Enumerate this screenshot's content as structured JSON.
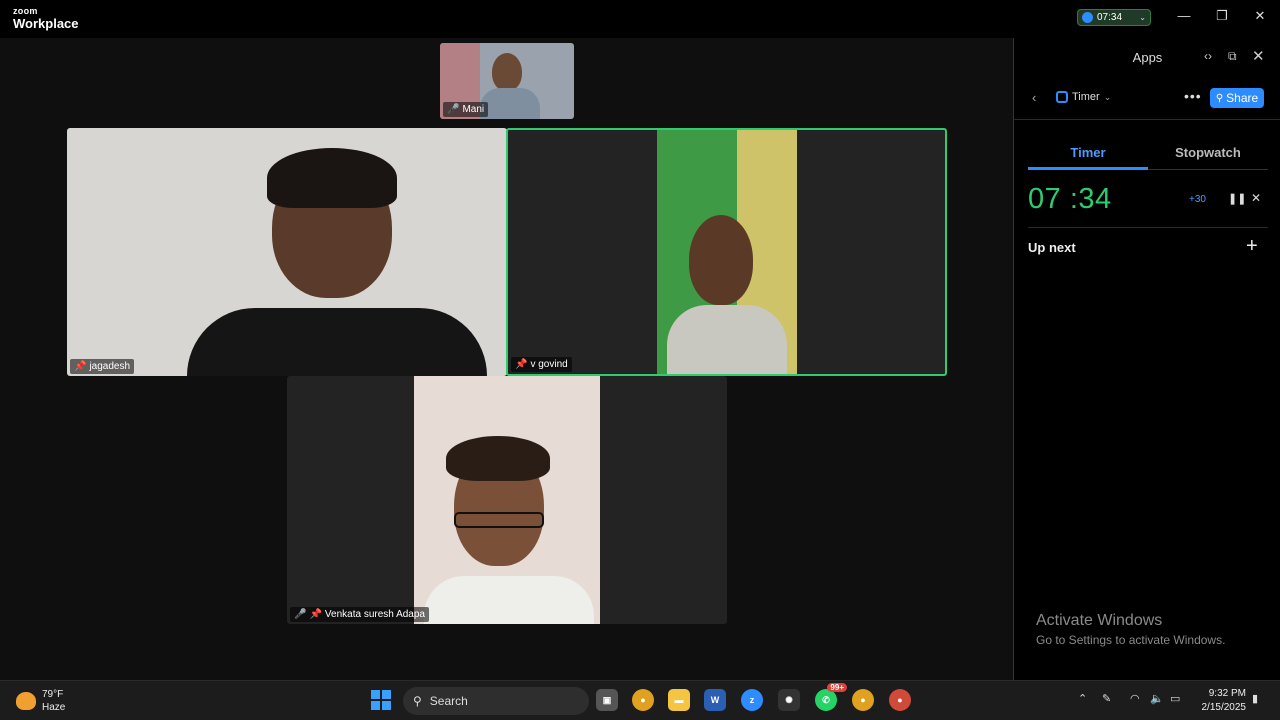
{
  "app": {
    "brand_small": "zoom",
    "brand_name": "Workplace",
    "timer_pill": "07:34"
  },
  "window_controls": {
    "minimize": "—",
    "maximize": "❐",
    "close": "✕"
  },
  "participants": {
    "top": {
      "name": "Mani"
    },
    "left": {
      "name": "jagadesh"
    },
    "right": {
      "name": "v govind"
    },
    "bottom": {
      "name": "Venkata suresh Adapa"
    }
  },
  "panel": {
    "title": "Apps",
    "app_name": "Timer",
    "share_label": "Share",
    "tabs": [
      "Timer",
      "Stopwatch"
    ],
    "clock": "07 :34",
    "add_time": "+30",
    "up_next": "Up next"
  },
  "watermark": {
    "line1": "Activate Windows",
    "line2": "Go to Settings to activate Windows."
  },
  "taskbar": {
    "temp": "79°F",
    "condition": "Haze",
    "search_placeholder": "Search",
    "whatsapp_badge": "99+",
    "time": "9:32 PM",
    "date": "2/15/2025"
  },
  "colors": {
    "accent": "#2d8cff",
    "active_border": "#2ecc71",
    "timer_green": "#2ecc71"
  }
}
